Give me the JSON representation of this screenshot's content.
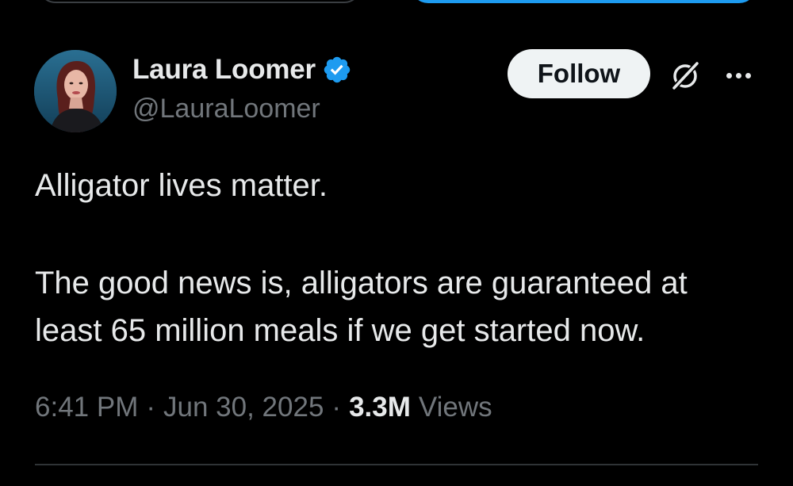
{
  "tweet": {
    "author": {
      "display_name": "Laura Loomer",
      "handle": "@LauraLoomer",
      "verified": true,
      "verified_color": "#1d9bf0"
    },
    "actions": {
      "follow_label": "Follow",
      "grok_icon": "grok-icon",
      "more_icon": "more-icon"
    },
    "text": {
      "line1": "Alligator lives matter.",
      "line2": "The good news is, alligators are guaranteed at",
      "line3": "least 65 million meals if we get started now."
    },
    "meta": {
      "time": "6:41 PM",
      "separator": "·",
      "date": "Jun 30, 2025",
      "views_count": "3.3M",
      "views_label": "Views"
    }
  },
  "colors": {
    "background": "#000000",
    "text_primary": "#e7e9ea",
    "text_secondary": "#71767b",
    "accent": "#1d9bf0",
    "follow_bg": "#eff3f4",
    "divider": "#2f3336"
  }
}
